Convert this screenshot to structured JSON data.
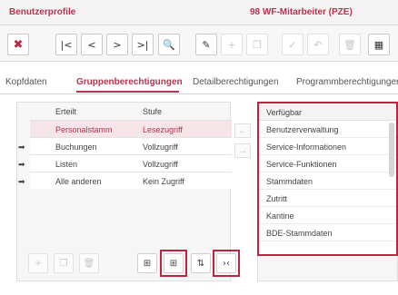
{
  "window": {
    "title": "Benutzerprofile",
    "info": "98  WF-Mitarbeiter (PZE)"
  },
  "toolbar": {
    "buttons": [
      {
        "name": "delete-red",
        "glyph": "✖"
      },
      {
        "name": "first",
        "glyph": "|<"
      },
      {
        "name": "prev",
        "glyph": "<"
      },
      {
        "name": "next",
        "glyph": ">"
      },
      {
        "name": "last",
        "glyph": ">|"
      },
      {
        "name": "search",
        "glyph": "🔍"
      },
      {
        "name": "edit",
        "glyph": "✎"
      },
      {
        "name": "add",
        "glyph": "+"
      },
      {
        "name": "copy",
        "glyph": "❐"
      },
      {
        "name": "confirm",
        "glyph": "✓"
      },
      {
        "name": "undo",
        "glyph": "↶"
      },
      {
        "name": "trash",
        "glyph": "🗑"
      },
      {
        "name": "table-settings",
        "glyph": "▦"
      }
    ]
  },
  "tabs": [
    "Kopfdaten",
    "Gruppenberechtigungen",
    "Detailberechtigungen",
    "Programmberechtigungen"
  ],
  "grid": {
    "headers": {
      "granted": "Erteilt",
      "level": "Stufe"
    },
    "rows": [
      {
        "granted": "Personalstamm",
        "level": "Lesezugriff",
        "selected": true,
        "arrow": ""
      },
      {
        "granted": "Buchungen",
        "level": "Vollzugriff",
        "selected": false,
        "arrow": "➡"
      },
      {
        "granted": "Listen",
        "level": "Vollzugriff",
        "selected": false,
        "arrow": "➡"
      },
      {
        "granted": "Alle anderen",
        "level": "Kein Zugriff",
        "selected": false,
        "arrow": "➡"
      }
    ]
  },
  "bottom_buttons": {
    "add": "+",
    "copy": "❐",
    "trash": "🗑",
    "grid_a": "⊞",
    "grid_b": "⊞",
    "sort": "⇅",
    "expand": "›‹"
  },
  "transfer": {
    "left": "←",
    "right": "→"
  },
  "available": {
    "header": "Verfügbar",
    "items": [
      "Benutzerverwaltung",
      "Service-Informationen",
      "Service-Funktionen",
      "Stammdaten",
      "Zutritt",
      "Kantine",
      "BDE-Stammdaten"
    ]
  },
  "colors": {
    "accent": "#b8334f",
    "highlight": "#c0233f"
  }
}
